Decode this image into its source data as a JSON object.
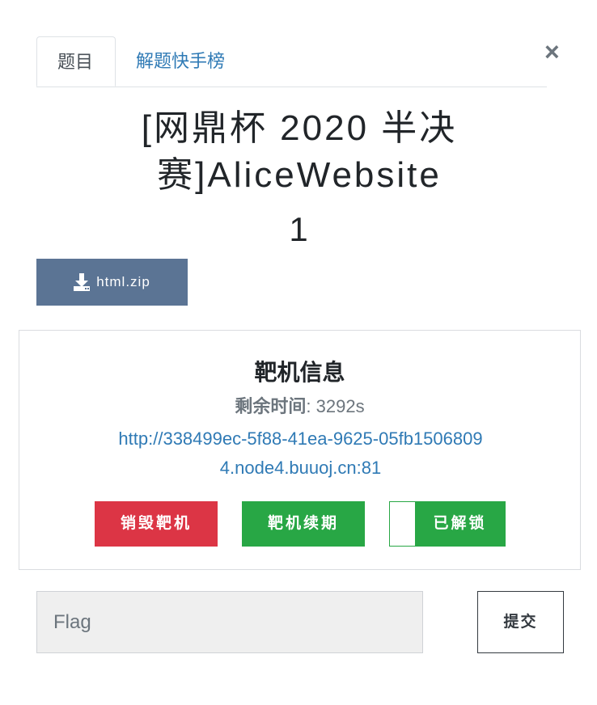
{
  "tabs": [
    {
      "label": "题目",
      "active": true
    },
    {
      "label": "解题快手榜",
      "active": false
    }
  ],
  "close_label": "×",
  "challenge": {
    "title": "[网鼎杯 2020 半决赛]AliceWebsite",
    "points": "1"
  },
  "download": {
    "filename": "html.zip",
    "icon": "download-icon"
  },
  "instance": {
    "heading": "靶机信息",
    "remaining_label": "剩余时间",
    "remaining_value": ": 3292s",
    "url": "http://338499ec-5f88-41ea-9625-05fb15068094.node4.buuoj.cn:81",
    "destroy_label": "销毁靶机",
    "renew_label": "靶机续期",
    "unlock_label": "已解锁"
  },
  "flag_form": {
    "placeholder": "Flag",
    "submit_label": "提交"
  },
  "colors": {
    "link": "#2f7ab5",
    "download_bg": "#5b7494",
    "danger": "#dc3545",
    "success": "#28a745"
  }
}
